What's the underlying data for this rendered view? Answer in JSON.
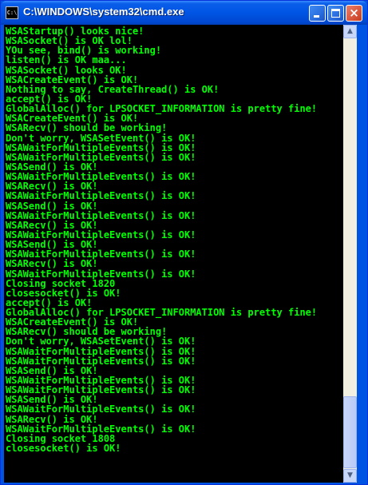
{
  "window": {
    "title": "C:\\WINDOWS\\system32\\cmd.exe",
    "app_icon_text": "C:\\",
    "buttons": {
      "minimize": "minimize",
      "maximize": "maximize",
      "close": "×"
    }
  },
  "console": {
    "lines": [
      "WSAStartup() looks nice!",
      "WSASocket() is OK lol!",
      "YOu see, bind() is working!",
      "listen() is OK maa...",
      "WSASocket() looks OK!",
      "WSACreateEvent() is OK!",
      "Nothing to say, CreateThread() is OK!",
      "accept() is OK!",
      "GlobalAlloc() for LPSOCKET_INFORMATION is pretty fine!",
      "WSACreateEvent() is OK!",
      "WSARecv() should be working!",
      "Don't worry, WSASetEvent() is OK!",
      "WSAWaitForMultipleEvents() is OK!",
      "WSAWaitForMultipleEvents() is OK!",
      "WSASend() is OK!",
      "WSAWaitForMultipleEvents() is OK!",
      "WSARecv() is OK!",
      "WSAWaitForMultipleEvents() is OK!",
      "WSASend() is OK!",
      "WSAWaitForMultipleEvents() is OK!",
      "WSARecv() is OK!",
      "WSAWaitForMultipleEvents() is OK!",
      "WSASend() is OK!",
      "WSAWaitForMultipleEvents() is OK!",
      "WSARecv() is OK!",
      "WSAWaitForMultipleEvents() is OK!",
      "Closing socket 1820",
      "closesocket() is OK!",
      "accept() is OK!",
      "GlobalAlloc() for LPSOCKET_INFORMATION is pretty fine!",
      "WSACreateEvent() is OK!",
      "WSARecv() should be working!",
      "Don't worry, WSASetEvent() is OK!",
      "WSAWaitForMultipleEvents() is OK!",
      "WSAWaitForMultipleEvents() is OK!",
      "WSASend() is OK!",
      "WSAWaitForMultipleEvents() is OK!",
      "WSAWaitForMultipleEvents() is OK!",
      "WSASend() is OK!",
      "WSAWaitForMultipleEvents() is OK!",
      "WSARecv() is OK!",
      "WSAWaitForMultipleEvents() is OK!",
      "Closing socket 1808",
      "closesocket() is OK!"
    ]
  },
  "scrollbar": {
    "up_arrow": "▲",
    "down_arrow": "▼"
  },
  "colors": {
    "console_text": "#00ff00",
    "console_bg": "#000000",
    "titlebar": "#0054e3"
  }
}
